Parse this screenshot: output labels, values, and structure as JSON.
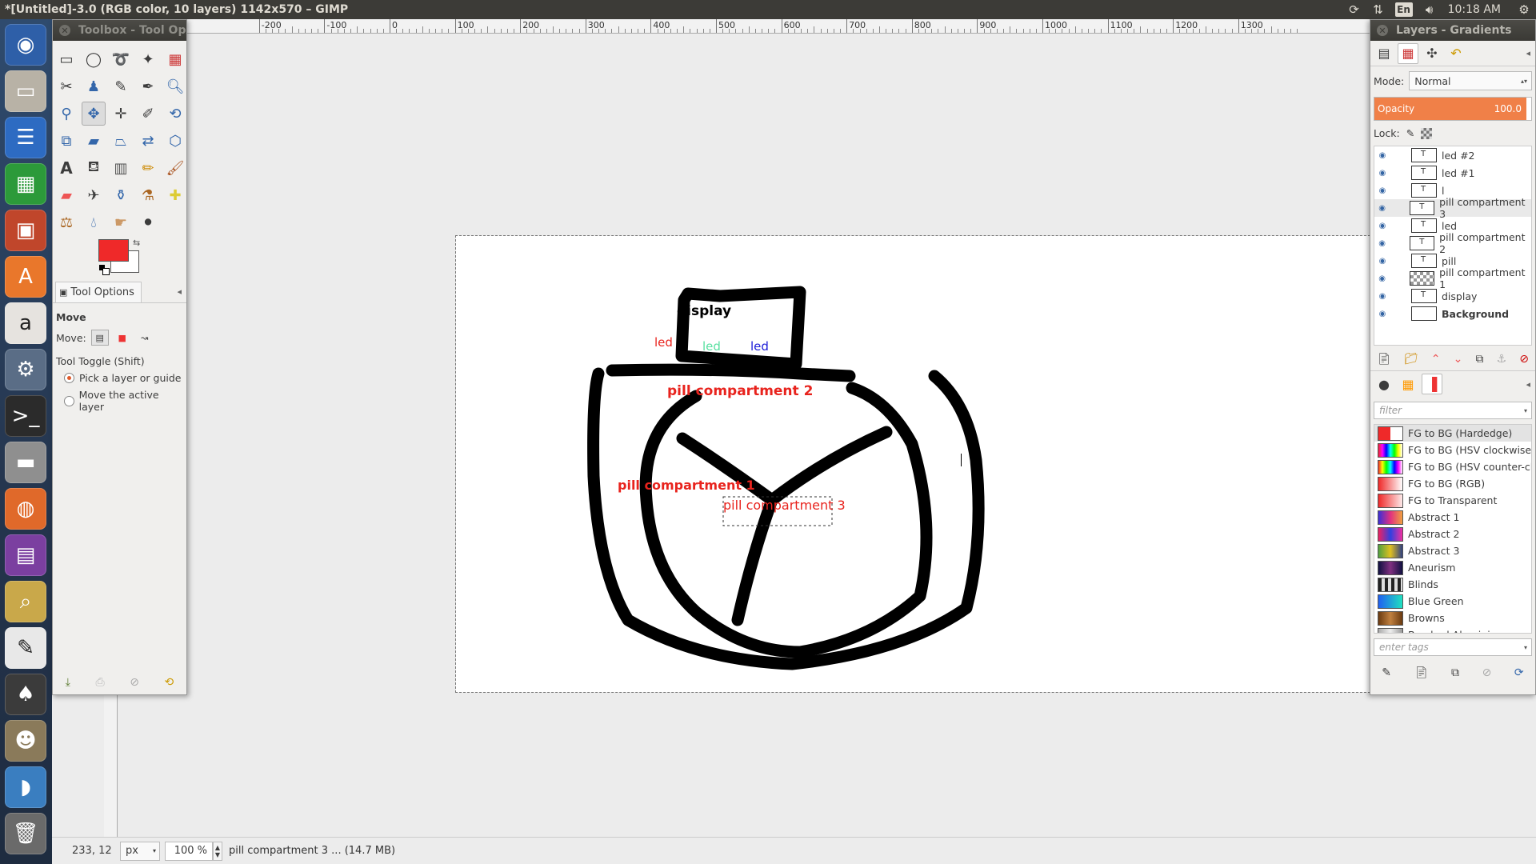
{
  "window_title": "*[Untitled]-3.0 (RGB color, 10 layers) 1142x570 – GIMP",
  "panel": {
    "keyboard": "En",
    "clock": "10:18 AM"
  },
  "launcher": [
    {
      "name": "dash-home-icon",
      "color": "#2e5fa8"
    },
    {
      "name": "files-icon",
      "color": "#b8b2a6"
    },
    {
      "name": "writer-icon",
      "color": "#2d6bc2"
    },
    {
      "name": "calc-icon",
      "color": "#2c9a3a"
    },
    {
      "name": "impress-icon",
      "color": "#c0462b"
    },
    {
      "name": "software-center-icon",
      "color": "#e9772b"
    },
    {
      "name": "amazon-icon",
      "color": "#e6e3df"
    },
    {
      "name": "system-settings-icon",
      "color": "#5a6d86"
    },
    {
      "name": "terminal-icon",
      "color": "#2b2b2b"
    },
    {
      "name": "drive-icon",
      "color": "#8f8f8f"
    },
    {
      "name": "firefox-icon",
      "color": "#e0692a"
    },
    {
      "name": "remote-desktop-icon",
      "color": "#7b3fa0"
    },
    {
      "name": "image-viewer-icon",
      "color": "#c9a84a"
    },
    {
      "name": "text-editor-icon",
      "color": "#e8e8e8"
    },
    {
      "name": "inkscape-icon",
      "color": "#3b3b3b"
    },
    {
      "name": "gimp-icon",
      "color": "#8a7a5a"
    },
    {
      "name": "swift-icon",
      "color": "#3a7ec0"
    },
    {
      "name": "trash-icon",
      "color": "#6a6a6a"
    }
  ],
  "ruler": {
    "labels": [
      "-200",
      "-100",
      "0",
      "100",
      "200",
      "300",
      "400",
      "500",
      "600",
      "700",
      "800",
      "900",
      "1000",
      "1100",
      "1200",
      "1300"
    ]
  },
  "toolbox": {
    "title": "Toolbox - Tool Op",
    "tab_label": "Tool Options",
    "tool_name": "Move",
    "move_label": "Move:",
    "toggle_label": "Tool Toggle  (Shift)",
    "radio_pick": "Pick a layer or guide",
    "radio_move": "Move the active layer",
    "fg_color": "#ef2929",
    "bg_color": "#ffffff"
  },
  "layers_dock": {
    "title": "Layers - Gradients",
    "mode_label": "Mode:",
    "mode_value": "Normal",
    "opacity_label": "Opacity",
    "opacity_value": "100.0",
    "opacity_fraction": 1.0,
    "lock_label": "Lock:",
    "layers": [
      {
        "name": "led #2",
        "selected": false,
        "bold": false
      },
      {
        "name": "led #1",
        "selected": false,
        "bold": false
      },
      {
        "name": "l",
        "selected": false,
        "bold": false
      },
      {
        "name": "pill compartment 3",
        "selected": true,
        "bold": false
      },
      {
        "name": "led",
        "selected": false,
        "bold": false
      },
      {
        "name": "pill compartment 2",
        "selected": false,
        "bold": false
      },
      {
        "name": "pill",
        "selected": false,
        "bold": false
      },
      {
        "name": "pill compartment 1",
        "selected": false,
        "bold": false
      },
      {
        "name": "display",
        "selected": false,
        "bold": false
      },
      {
        "name": "Background",
        "selected": false,
        "bold": true
      }
    ],
    "filter_placeholder": "filter",
    "tags_placeholder": "enter tags",
    "gradients": [
      {
        "name": "FG to BG (Hardedge)",
        "swatch": "linear-gradient(90deg,#ef2929 50%,#fff 50%)",
        "selected": true
      },
      {
        "name": "FG to BG (HSV clockwise h",
        "swatch": "linear-gradient(90deg,#ef2929,#f0f,#00f,#0ff,#0f0,#ff0,#fff)",
        "selected": false
      },
      {
        "name": "FG to BG (HSV counter-clo",
        "swatch": "linear-gradient(90deg,#ef2929,#ff0,#0f0,#0ff,#00f,#f0f,#fff)",
        "selected": false
      },
      {
        "name": "FG to BG (RGB)",
        "swatch": "linear-gradient(90deg,#ef2929,#fff)",
        "selected": false
      },
      {
        "name": "FG to Transparent",
        "swatch": "linear-gradient(90deg,#ef2929,rgba(239,41,41,0.1))",
        "selected": false
      },
      {
        "name": "Abstract 1",
        "swatch": "linear-gradient(90deg,#3a2fd6,#e03080,#f0a040)",
        "selected": false
      },
      {
        "name": "Abstract 2",
        "swatch": "linear-gradient(90deg,#f02060,#3040e0,#f030a0)",
        "selected": false
      },
      {
        "name": "Abstract 3",
        "swatch": "linear-gradient(90deg,#50a040,#e0c020,#304080)",
        "selected": false
      },
      {
        "name": "Aneurism",
        "swatch": "linear-gradient(90deg,#101040,#803080,#101040)",
        "selected": false
      },
      {
        "name": "Blinds",
        "swatch": "repeating-linear-gradient(90deg,#222 0 4px,#ddd 4px 8px)",
        "selected": false
      },
      {
        "name": "Blue Green",
        "swatch": "linear-gradient(90deg,#2060f0,#20e0c0)",
        "selected": false
      },
      {
        "name": "Browns",
        "swatch": "linear-gradient(90deg,#6a3a10,#c08040,#6a3a10)",
        "selected": false
      },
      {
        "name": "Brushed Aluminium",
        "swatch": "linear-gradient(90deg,#aaa,#eee,#999)",
        "selected": false
      }
    ]
  },
  "canvas": {
    "labels": {
      "display": "display",
      "led_red": "led",
      "led_green": "led",
      "led_blue": "led",
      "pc2": "pill compartment 2",
      "pc1": "pill compartment 1",
      "pc3": "pill compartment 3"
    },
    "colors": {
      "red": "#e8231d",
      "green": "#58e0a0",
      "blue": "#1a1ad8",
      "black": "#000000"
    }
  },
  "status": {
    "coords": "233, 12",
    "unit": "px",
    "zoom": "100 %",
    "message": "pill compartment 3 ... (14.7 MB)"
  }
}
